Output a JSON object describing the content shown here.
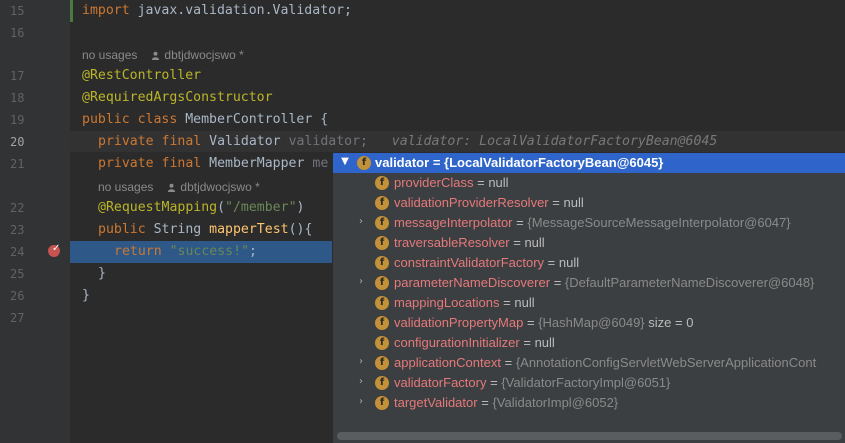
{
  "editor": {
    "line_numbers": [
      "15",
      "16",
      "17",
      "18",
      "19",
      "20",
      "21",
      "22",
      "23",
      "24",
      "25",
      "26",
      "27"
    ],
    "usage_blocks": [
      {
        "usages": "no usages",
        "author": "dbtjdwocjswo *"
      },
      {
        "usages": "no usages",
        "author": "dbtjdwocjswo *"
      }
    ],
    "lines": {
      "l15": {
        "kw": "import",
        "rest": " javax.validation.Validator;"
      },
      "l17": {
        "ann": "@RestController"
      },
      "l18": {
        "ann": "@RequiredArgsConstructor"
      },
      "l19": {
        "kw1": "public",
        "kw2": "class",
        "rest": " MemberController {"
      },
      "l20": {
        "kw": "private final",
        "type": " Validator ",
        "var": "validator;",
        "hint": "validator: LocalValidatorFactoryBean@6045"
      },
      "l21": {
        "kw": "private final",
        "type": " MemberMapper ",
        "var": "me"
      },
      "l22": {
        "ann": "@RequestMapping",
        "open": "(",
        "str": "\"/member\"",
        "close": ")"
      },
      "l23": {
        "kw": "public",
        "type": " String ",
        "method": "mapperTest",
        "rest": "(){"
      },
      "l24": {
        "kw": "return",
        "str": " \"success!\"",
        "rest": ";"
      },
      "l25": {
        "rest": "}"
      },
      "l26": {
        "rest": "}"
      }
    }
  },
  "debug_popup": {
    "root": {
      "name": "validator",
      "value": "{LocalValidatorFactoryBean@6045}"
    },
    "fields": [
      {
        "name": "providerClass",
        "value": "null",
        "expandable": false
      },
      {
        "name": "validationProviderResolver",
        "value": "null",
        "expandable": false
      },
      {
        "name": "messageInterpolator",
        "value": "{MessageSourceMessageInterpolator@6047}",
        "expandable": true
      },
      {
        "name": "traversableResolver",
        "value": "null",
        "expandable": false
      },
      {
        "name": "constraintValidatorFactory",
        "value": "null",
        "expandable": false
      },
      {
        "name": "parameterNameDiscoverer",
        "value": "{DefaultParameterNameDiscoverer@6048}",
        "expandable": true
      },
      {
        "name": "mappingLocations",
        "value": "null",
        "expandable": false
      },
      {
        "name": "validationPropertyMap",
        "value": "{HashMap@6049}",
        "extra": "size = 0",
        "expandable": false
      },
      {
        "name": "configurationInitializer",
        "value": "null",
        "expandable": false
      },
      {
        "name": "applicationContext",
        "value": "{AnnotationConfigServletWebServerApplicationCont",
        "expandable": true
      },
      {
        "name": "validatorFactory",
        "value": "{ValidatorFactoryImpl@6051}",
        "expandable": true
      },
      {
        "name": "targetValidator",
        "value": "{ValidatorImpl@6052}",
        "expandable": true
      }
    ],
    "equals_sign": "="
  },
  "colors": {
    "editor_bg": "#2b2b2b",
    "popup_bg": "#3c3f41",
    "selection": "#2f65ca",
    "field_icon": "#c39137"
  }
}
